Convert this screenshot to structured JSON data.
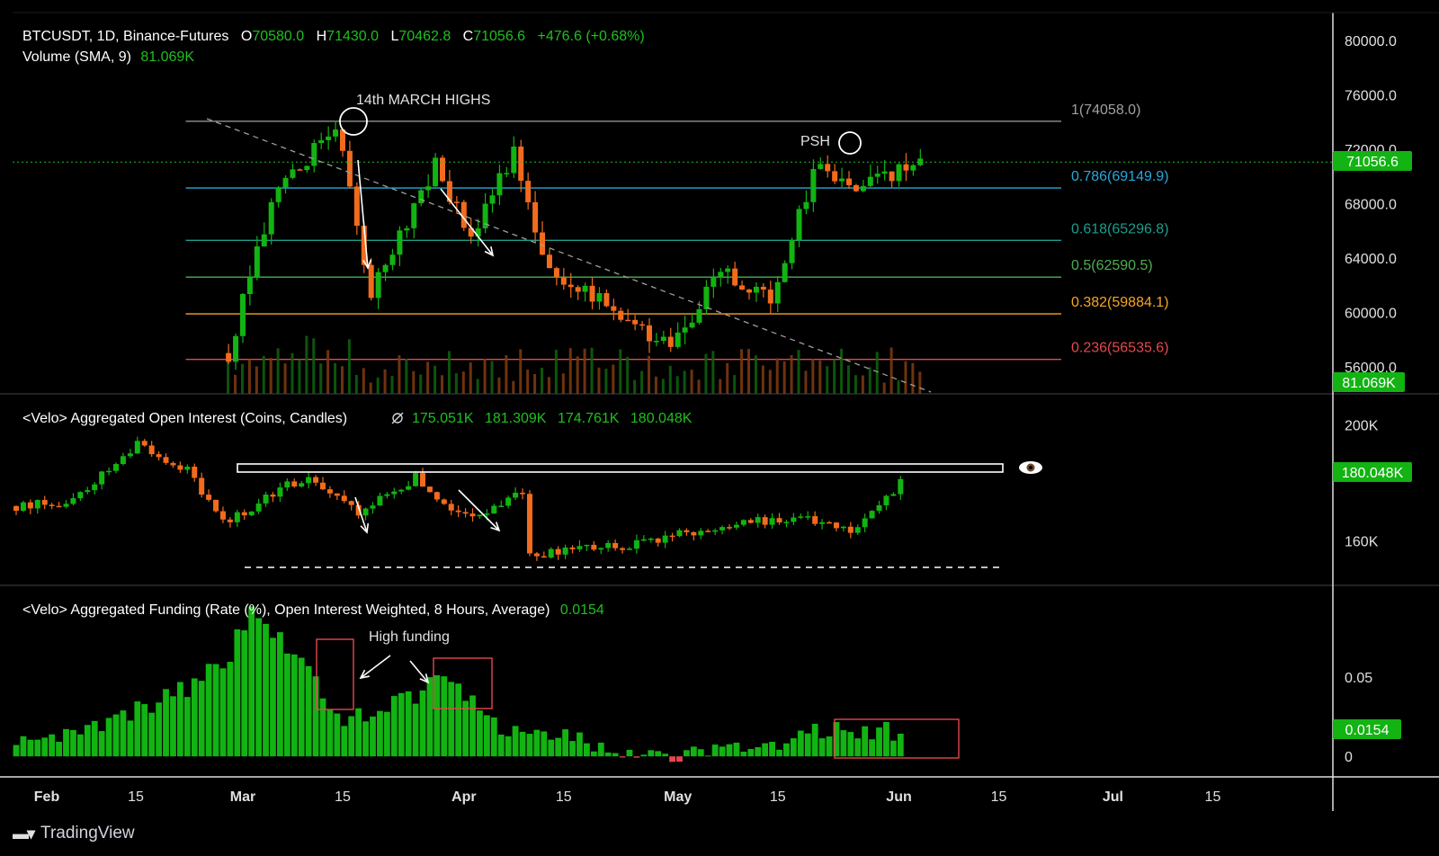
{
  "header": {
    "symbol": "BTCUSDT, 1D, Binance-Futures",
    "o_label": "O",
    "o": "70580.0",
    "h_label": "H",
    "h": "71430.0",
    "l_label": "L",
    "l": "70462.8",
    "c_label": "C",
    "c": "71056.6",
    "change": "+476.6 (+0.68%)",
    "volume_label": "Volume (SMA, 9)",
    "volume_value": "81.069K"
  },
  "oi_header": {
    "label": "<Velo> Aggregated Open Interest (Coins, Candles)",
    "icon": "hidden-eye-icon",
    "values": [
      "175.051K",
      "181.309K",
      "174.761K",
      "180.048K"
    ]
  },
  "funding_header": {
    "label": "<Velo> Aggregated Funding (Rate (%), Open Interest Weighted, 8 Hours, Average)",
    "value": "0.0154"
  },
  "annotations": {
    "march_highs": "14th MARCH HIGHS",
    "psh": "PSH",
    "high_funding": "High funding"
  },
  "price_axis": {
    "labels": [
      "80000.0",
      "76000.0",
      "72000.0",
      "68000.0",
      "64000.0",
      "60000.0",
      "56000.0"
    ]
  },
  "price_badges": {
    "last": "71056.6",
    "volume": "81.069K"
  },
  "oi_axis": {
    "labels": [
      "200K",
      "160K"
    ],
    "badge": "180.048K"
  },
  "funding_axis": {
    "labels": [
      "0.05",
      "0"
    ],
    "badge": "0.0154"
  },
  "time_axis": {
    "labels": [
      "Feb",
      "15",
      "Mar",
      "15",
      "Apr",
      "15",
      "May",
      "15",
      "Jun",
      "15",
      "Jul",
      "15"
    ]
  },
  "brand": {
    "name": "TradingView"
  },
  "colors": {
    "bg": "#000000",
    "up": "#12b312",
    "down": "#f26b1d",
    "text": "#d1d4dc",
    "grid_sep": "#2a2e39",
    "last_price": "#1fbf1f",
    "header_green": "#1fbf1f"
  },
  "chart_data": [
    {
      "type": "candlestick",
      "title": "BTCUSDT, 1D, Binance-Futures",
      "x_range": [
        "2024-02-01",
        "2024-07-20"
      ],
      "ylim": [
        54000,
        81000
      ],
      "y_ticks": [
        56000,
        60000,
        64000,
        68000,
        72000,
        76000,
        80000
      ],
      "last_close": 71056.6,
      "key_points": [
        {
          "date": "2024-02-28",
          "value": 57000
        },
        {
          "date": "2024-03-05",
          "value": 68000
        },
        {
          "date": "2024-03-14",
          "value": 73700
        },
        {
          "date": "2024-03-19",
          "value": 61500
        },
        {
          "date": "2024-03-28",
          "value": 71000
        },
        {
          "date": "2024-04-02",
          "value": 65500
        },
        {
          "date": "2024-04-08",
          "value": 71800
        },
        {
          "date": "2024-04-13",
          "value": 63000
        },
        {
          "date": "2024-04-30",
          "value": 57500
        },
        {
          "date": "2024-05-07",
          "value": 63000
        },
        {
          "date": "2024-05-14",
          "value": 61000
        },
        {
          "date": "2024-05-21",
          "value": 71500
        },
        {
          "date": "2024-05-25",
          "value": 69000
        },
        {
          "date": "2024-06-04",
          "value": 71056.6
        }
      ],
      "fib_levels": [
        {
          "label": "1(74058.0)",
          "value": 74058.0,
          "color": "#a0a0a0"
        },
        {
          "label": "0.786(69149.9)",
          "value": 69149.9,
          "color": "#29a8d8"
        },
        {
          "label": "0.618(65296.8)",
          "value": 65296.8,
          "color": "#1e9c8a"
        },
        {
          "label": "0.5(62590.5)",
          "value": 62590.5,
          "color": "#4caf50"
        },
        {
          "label": "0.382(59884.1)",
          "value": 59884.1,
          "color": "#f5a623"
        },
        {
          "label": "0.236(56535.6)",
          "value": 56535.6,
          "color": "#e5484d"
        }
      ],
      "volume_sma": 81.069
    },
    {
      "type": "candlestick",
      "title": "<Velo> Aggregated Open Interest (Coins, Candles)",
      "ylim": [
        145000,
        210000
      ],
      "y_ticks": [
        160000,
        200000
      ],
      "ohlc_last": [
        175051,
        181309,
        174761,
        180048
      ],
      "key_points": [
        {
          "date": "2024-02-01",
          "value": 172000
        },
        {
          "date": "2024-02-08",
          "value": 173000
        },
        {
          "date": "2024-02-18",
          "value": 193000
        },
        {
          "date": "2024-02-25",
          "value": 185000
        },
        {
          "date": "2024-03-01",
          "value": 166000
        },
        {
          "date": "2024-03-13",
          "value": 183000
        },
        {
          "date": "2024-03-20",
          "value": 169000
        },
        {
          "date": "2024-03-28",
          "value": 182000
        },
        {
          "date": "2024-04-04",
          "value": 168000
        },
        {
          "date": "2024-04-12",
          "value": 176000
        },
        {
          "date": "2024-04-13",
          "value": 155000
        },
        {
          "date": "2024-05-01",
          "value": 160000
        },
        {
          "date": "2024-05-10",
          "value": 166000
        },
        {
          "date": "2024-05-22",
          "value": 168000
        },
        {
          "date": "2024-05-28",
          "value": 163000
        },
        {
          "date": "2024-06-04",
          "value": 180048
        }
      ]
    },
    {
      "type": "bar",
      "title": "<Velo> Aggregated Funding (Rate (%), Open Interest Weighted, 8 Hours, Average)",
      "ylim": [
        -0.005,
        0.1
      ],
      "y_ticks": [
        0,
        0.05
      ],
      "last_value": 0.0154,
      "key_points": [
        {
          "date": "2024-02-01",
          "value": 0.011
        },
        {
          "date": "2024-02-12",
          "value": 0.018
        },
        {
          "date": "2024-02-26",
          "value": 0.045
        },
        {
          "date": "2024-03-02",
          "value": 0.065
        },
        {
          "date": "2024-03-05",
          "value": 0.095
        },
        {
          "date": "2024-03-12",
          "value": 0.06
        },
        {
          "date": "2024-03-18",
          "value": 0.022
        },
        {
          "date": "2024-03-28",
          "value": 0.038
        },
        {
          "date": "2024-04-01",
          "value": 0.055
        },
        {
          "date": "2024-04-08",
          "value": 0.02
        },
        {
          "date": "2024-04-25",
          "value": 0.005
        },
        {
          "date": "2024-05-01",
          "value": -0.002
        },
        {
          "date": "2024-05-20",
          "value": 0.01
        },
        {
          "date": "2024-05-25",
          "value": 0.018
        },
        {
          "date": "2024-06-04",
          "value": 0.0154
        }
      ]
    }
  ]
}
